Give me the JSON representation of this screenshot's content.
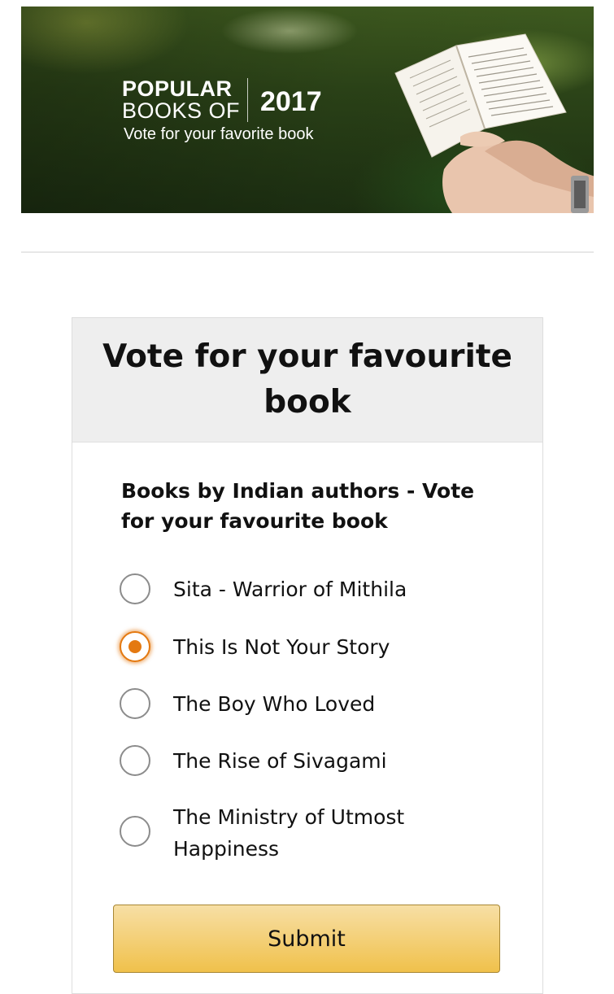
{
  "banner": {
    "title_line1": "POPULAR",
    "title_line2": "BOOKS OF",
    "year": "2017",
    "subtitle": "Vote for your favorite book"
  },
  "poll": {
    "title": "Vote for your favourite book",
    "question": "Books by Indian authors - Vote for your favourite book",
    "options": [
      {
        "label": "Sita - Warrior of Mithila",
        "selected": false
      },
      {
        "label": "This Is Not Your Story",
        "selected": true
      },
      {
        "label": "The Boy Who Loved",
        "selected": false
      },
      {
        "label": "The Rise of Sivagami",
        "selected": false
      },
      {
        "label": "The Ministry of Utmost Happiness",
        "selected": false
      }
    ],
    "submit_label": "Submit"
  },
  "colors": {
    "accent": "#e47911",
    "button_top": "#f7dfa5",
    "button_bottom": "#f0c14b",
    "header_bg": "#eeeeee"
  }
}
